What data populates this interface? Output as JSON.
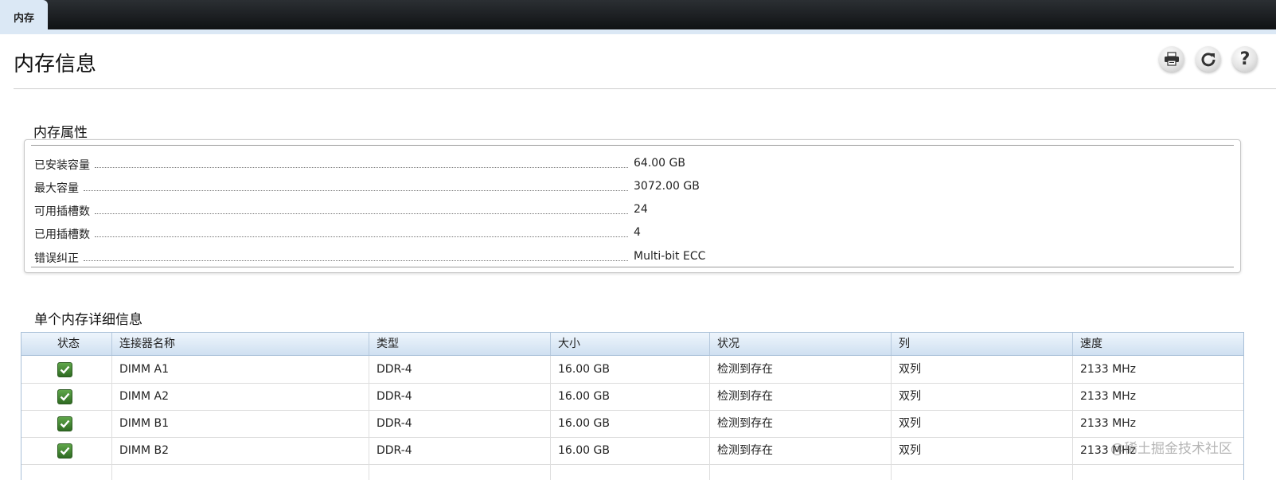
{
  "tabs": [
    {
      "label": "内存"
    }
  ],
  "page": {
    "title": "内存信息"
  },
  "toolbar": {
    "icons": [
      "printer-icon",
      "refresh-icon",
      "help-icon"
    ],
    "help_glyph": "?"
  },
  "properties": {
    "title": "内存属性",
    "rows": [
      {
        "label": "已安装容量",
        "value": "64.00 GB"
      },
      {
        "label": "最大容量",
        "value": "3072.00 GB"
      },
      {
        "label": "可用插槽数",
        "value": "24"
      },
      {
        "label": "已用插槽数",
        "value": "4"
      },
      {
        "label": "错误纠正",
        "value": "Multi-bit ECC"
      }
    ]
  },
  "details": {
    "title": "单个内存详细信息",
    "columns": [
      "状态",
      "连接器名称",
      "类型",
      "大小",
      "状况",
      "列",
      "速度"
    ],
    "rows": [
      {
        "status": "ok",
        "connector": "DIMM A1",
        "type": "DDR-4",
        "size": "16.00 GB",
        "condition": "检测到存在",
        "rank": "双列",
        "speed": "2133 MHz"
      },
      {
        "status": "ok",
        "connector": "DIMM A2",
        "type": "DDR-4",
        "size": "16.00 GB",
        "condition": "检测到存在",
        "rank": "双列",
        "speed": "2133 MHz"
      },
      {
        "status": "ok",
        "connector": "DIMM B1",
        "type": "DDR-4",
        "size": "16.00 GB",
        "condition": "检测到存在",
        "rank": "双列",
        "speed": "2133 MHz"
      },
      {
        "status": "ok",
        "connector": "DIMM B2",
        "type": "DDR-4",
        "size": "16.00 GB",
        "condition": "检测到存在",
        "rank": "双列",
        "speed": "2133 MHz"
      }
    ]
  },
  "watermark": "@稀土掘金技术社区",
  "colors": {
    "status_ok": "#3f8a2e",
    "header_bg": "#cfe0f1",
    "tabbar": "#1a1d20"
  }
}
